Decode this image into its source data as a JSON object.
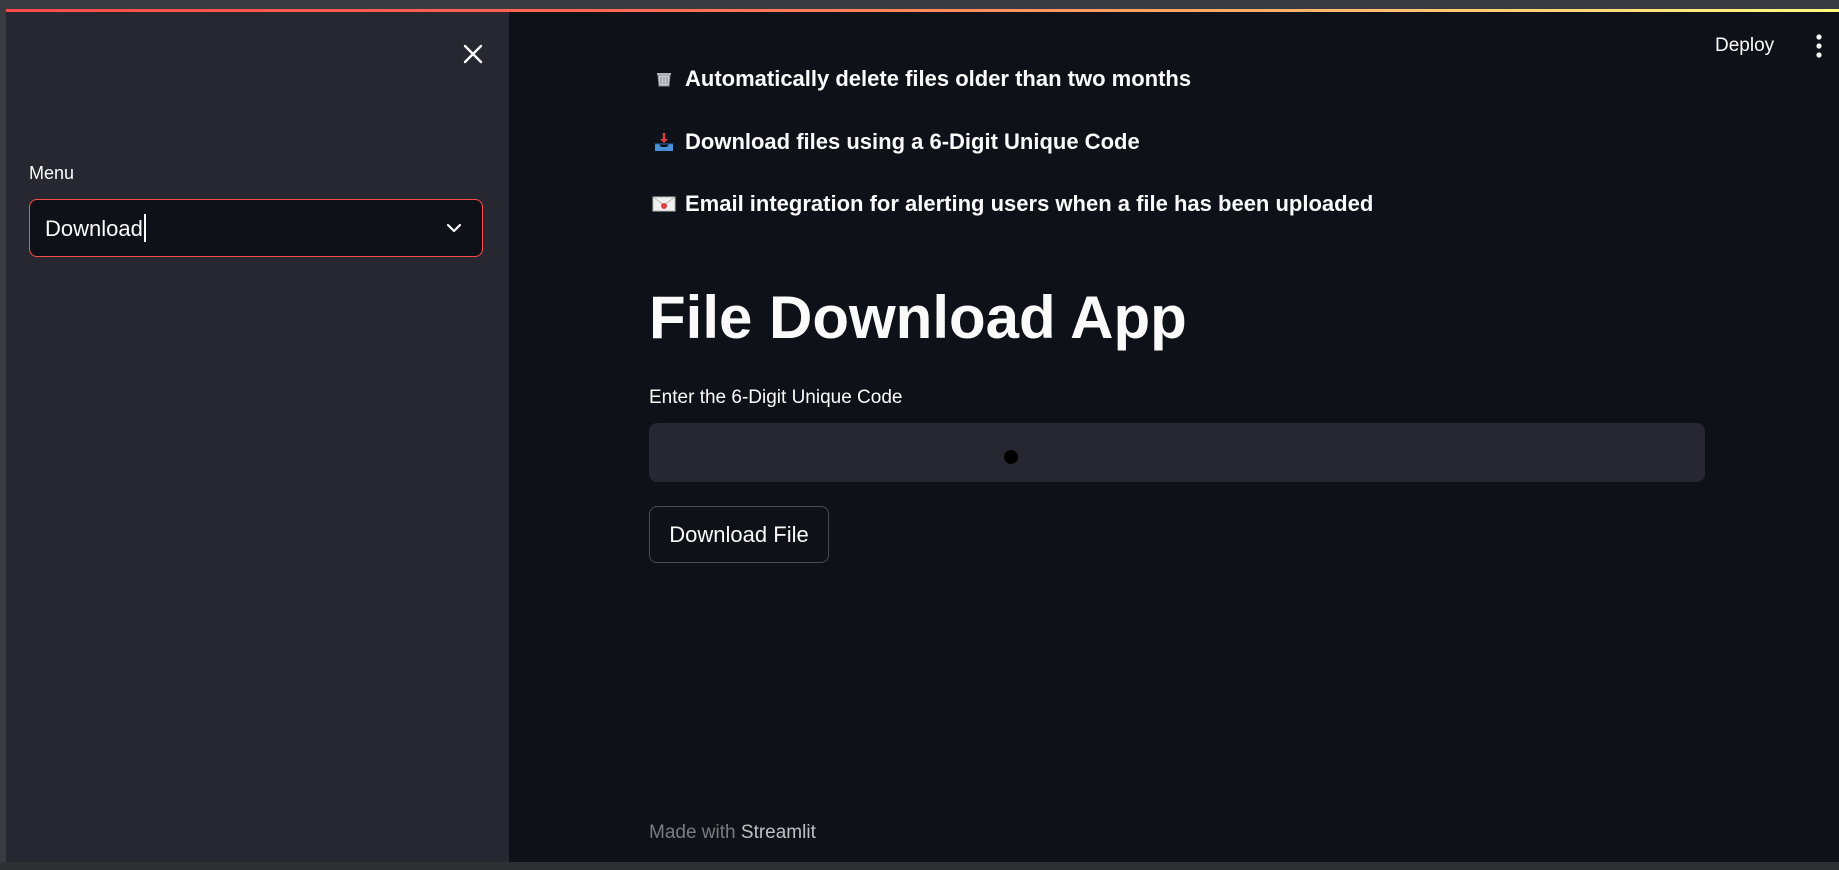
{
  "sidebar": {
    "menu_label": "Menu",
    "menu_value": "Download"
  },
  "header": {
    "deploy_label": "Deploy"
  },
  "features": [
    {
      "icon": "wastebasket-icon",
      "text": "Automatically delete files older than two months"
    },
    {
      "icon": "inbox-tray-icon",
      "text": "Download files using a 6-Digit Unique Code"
    },
    {
      "icon": "envelope-icon",
      "text": "Email integration for alerting users when a file has been uploaded"
    }
  ],
  "main": {
    "title": "File Download App",
    "code_label": "Enter the 6-Digit Unique Code",
    "code_value": "",
    "download_button": "Download File"
  },
  "footer": {
    "made_with": "Made with",
    "brand": "Streamlit"
  },
  "colors": {
    "accent": "#ff4b4b",
    "background": "#0e1117",
    "sidebar": "#262730",
    "text": "#fafafa"
  }
}
